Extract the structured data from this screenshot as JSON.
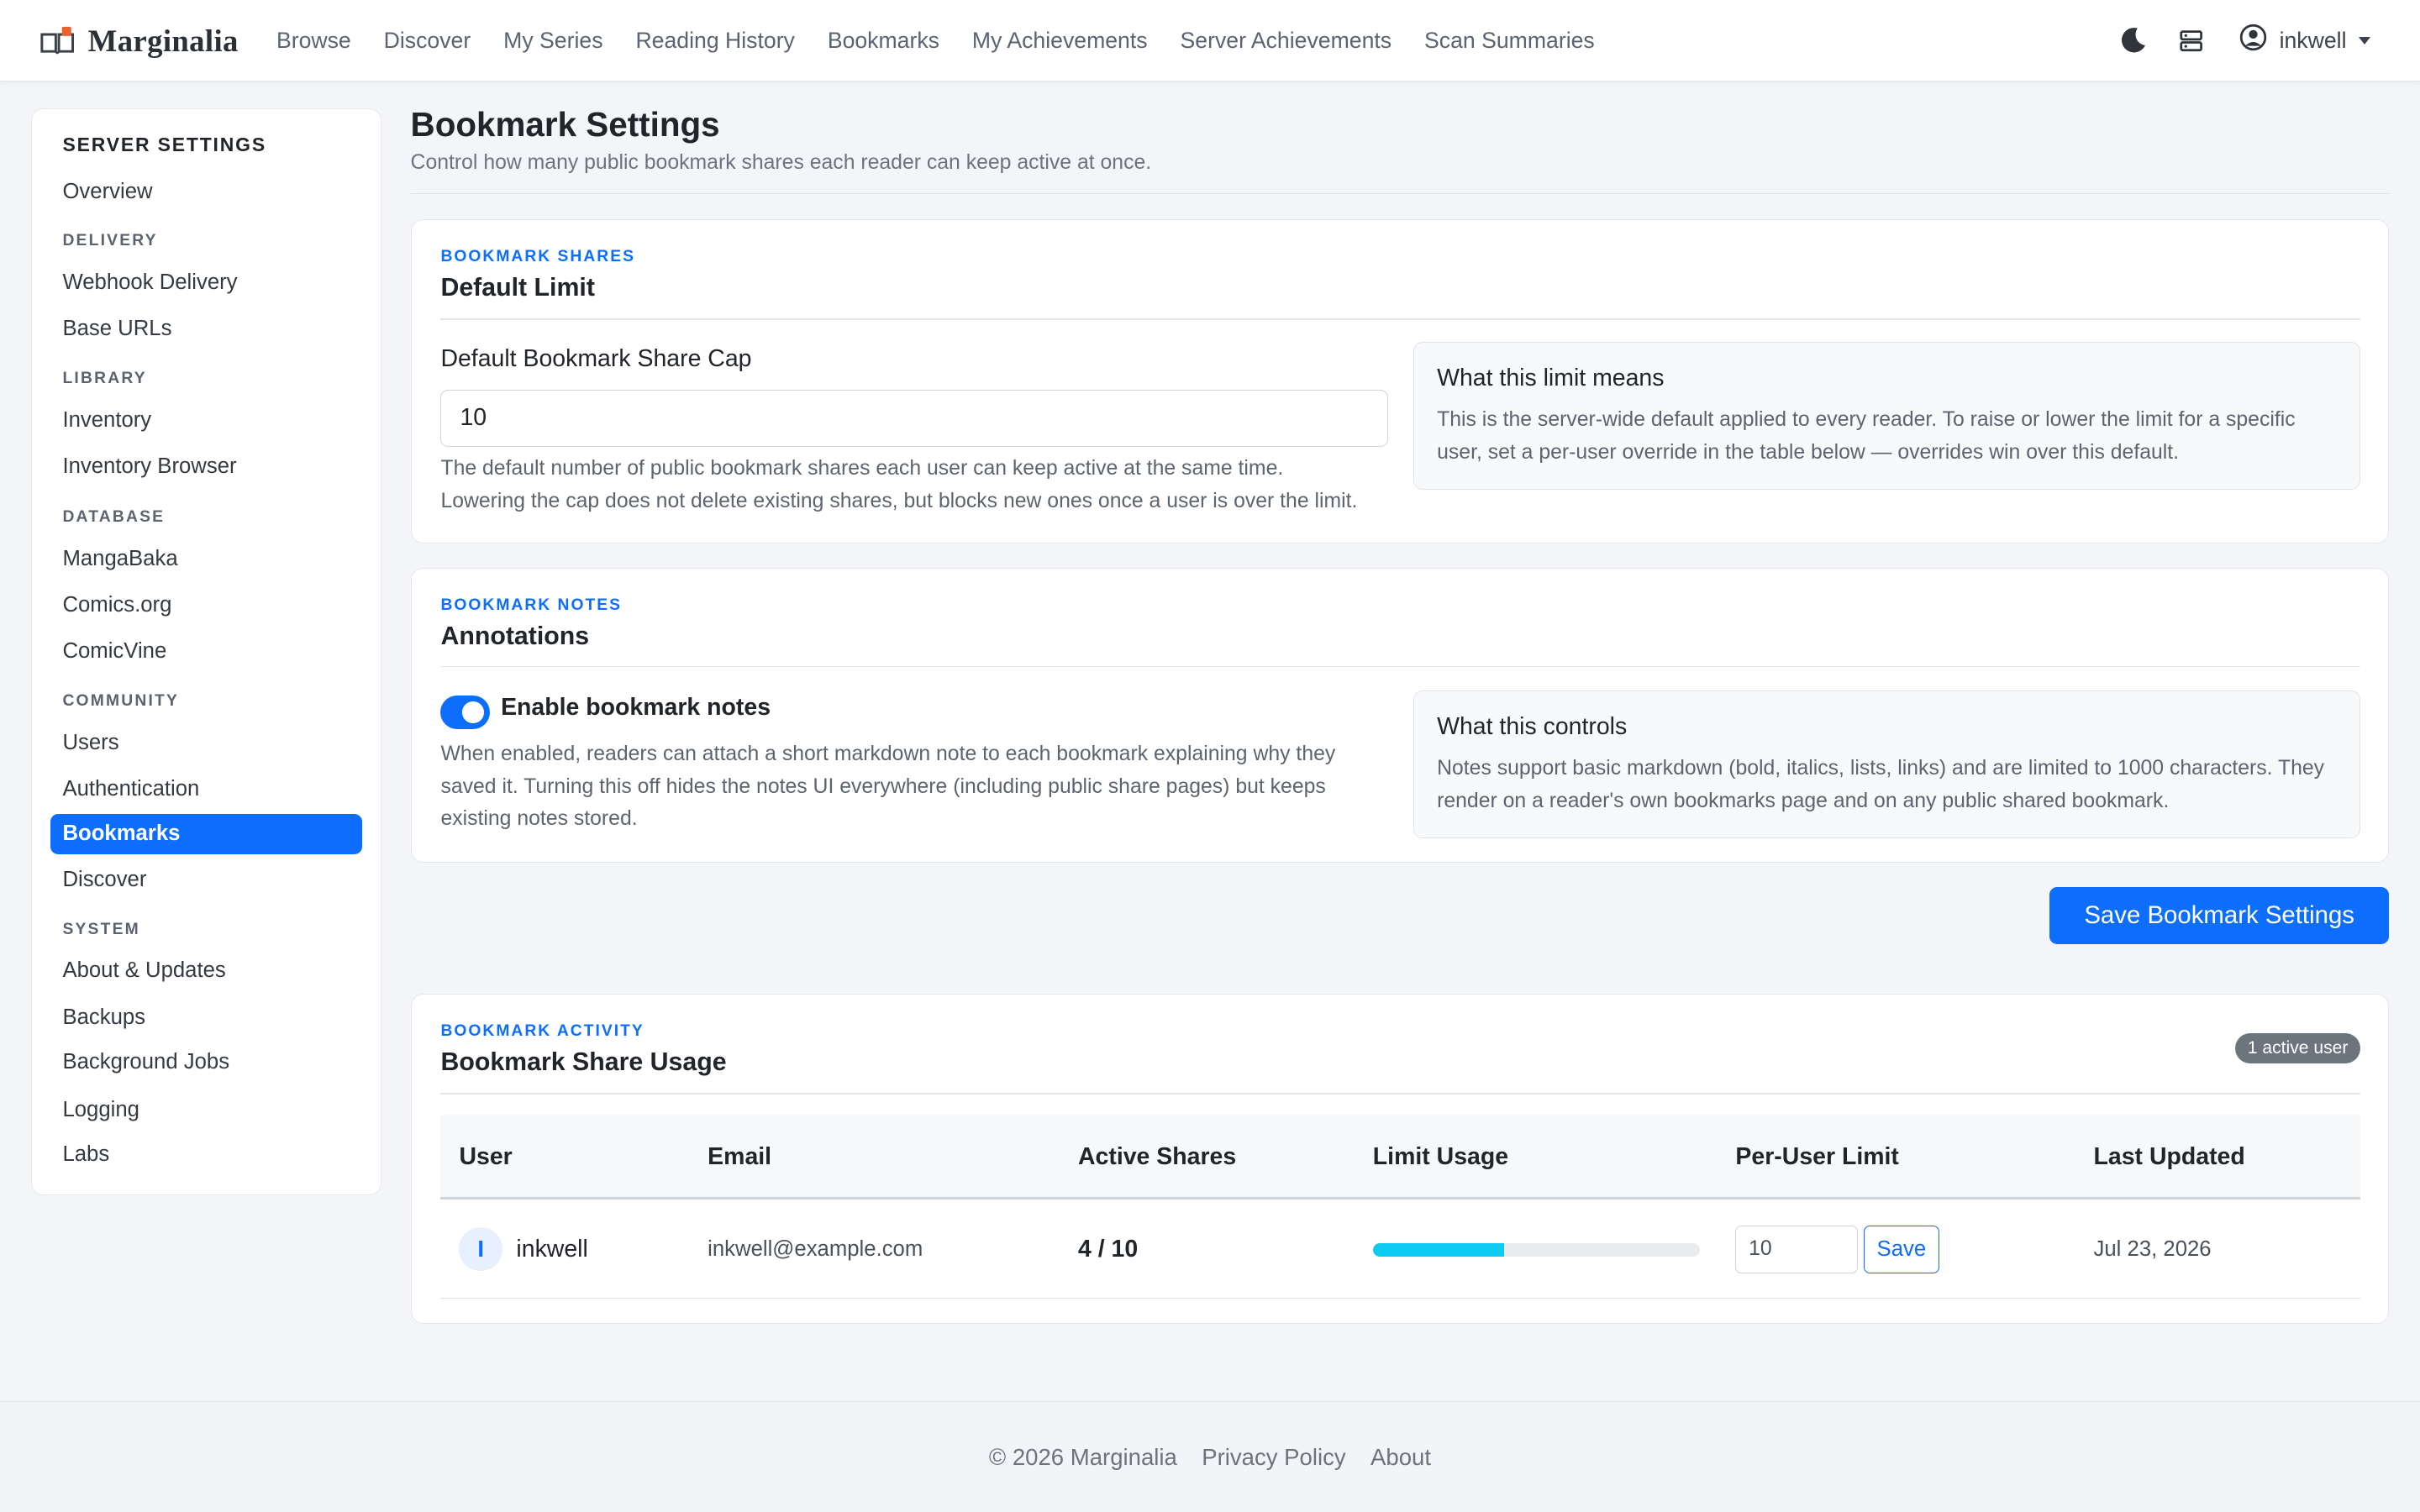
{
  "brand": {
    "name": "Marginalia"
  },
  "nav": {
    "links": [
      "Browse",
      "Discover",
      "My Series",
      "Reading History",
      "Bookmarks",
      "My Achievements",
      "Server Achievements",
      "Scan Summaries"
    ],
    "user": "inkwell"
  },
  "sidebar": {
    "title": "SERVER SETTINGS",
    "overview": "Overview",
    "sections": {
      "delivery": "DELIVERY",
      "library": "LIBRARY",
      "database": "DATABASE",
      "community": "COMMUNITY",
      "system": "SYSTEM"
    },
    "items": {
      "webhook": "Webhook Delivery",
      "base_urls": "Base URLs",
      "inventory": "Inventory",
      "inventory_browser": "Inventory Browser",
      "mangabaka": "MangaBaka",
      "comics_org": "Comics.org",
      "comicvine": "ComicVine",
      "users": "Users",
      "authentication": "Authentication",
      "bookmarks": "Bookmarks",
      "discover": "Discover",
      "about": "About & Updates",
      "backups": "Backups",
      "background_jobs": "Background Jobs",
      "logging": "Logging",
      "labs": "Labs"
    },
    "active": "Bookmarks"
  },
  "page": {
    "title": "Bookmark Settings",
    "subtitle": "Control how many public bookmark shares each reader can keep active at once."
  },
  "shares_card": {
    "eyebrow": "BOOKMARK SHARES",
    "heading": "Default Limit",
    "field_label": "Default Bookmark Share Cap",
    "field_value": "10",
    "help_line1": "The default number of public bookmark shares each user can keep active at the same time.",
    "help_line2": "Lowering the cap does not delete existing shares, but blocks new ones once a user is over the limit.",
    "info_title": "What this limit means",
    "info_text": "This is the server-wide default applied to every reader. To raise or lower the limit for a specific user, set a per-user override in the table below — overrides win over this default."
  },
  "notes_card": {
    "eyebrow": "BOOKMARK NOTES",
    "heading": "Annotations",
    "toggle_label": "Enable bookmark notes",
    "toggle_on": true,
    "help": "When enabled, readers can attach a short markdown note to each bookmark explaining why they saved it. Turning this off hides the notes UI everywhere (including public share pages) but keeps existing notes stored.",
    "info_title": "What this controls",
    "info_text": "Notes support basic markdown (bold, italics, lists, links) and are limited to 1000 characters. They render on a reader's own bookmarks page and on any public shared bookmark."
  },
  "save_button": "Save Bookmark Settings",
  "activity_card": {
    "eyebrow": "BOOKMARK ACTIVITY",
    "heading": "Bookmark Share Usage",
    "badge": "1 active user",
    "columns": [
      "User",
      "Email",
      "Active Shares",
      "Limit Usage",
      "Per-User Limit",
      "Last Updated"
    ],
    "rows": [
      {
        "initial": "I",
        "user": "inkwell",
        "email": "inkwell@example.com",
        "active_shares": "4 / 10",
        "usage_fraction": 0.4,
        "per_user_limit": "10",
        "save_label": "Save",
        "last_updated": "Jul 23, 2026"
      }
    ]
  },
  "footer": {
    "copyright": "© 2026 Marginalia",
    "privacy": "Privacy Policy",
    "about": "About"
  },
  "colors": {
    "accent": "#0d6efd",
    "progress": "#0dcaf0",
    "badge": "#6c757d"
  }
}
